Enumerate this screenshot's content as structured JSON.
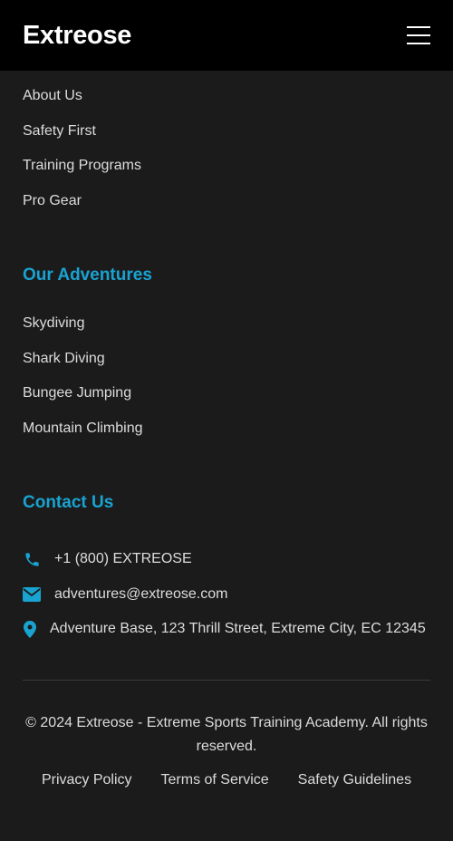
{
  "header": {
    "logo": "Extreose",
    "menu_icon": "hamburger-menu-icon"
  },
  "quick_links": {
    "items": [
      {
        "label": "About Us"
      },
      {
        "label": "Safety First"
      },
      {
        "label": "Training Programs"
      },
      {
        "label": "Pro Gear"
      }
    ]
  },
  "adventures": {
    "title": "Our Adventures",
    "items": [
      {
        "label": "Skydiving"
      },
      {
        "label": "Shark Diving"
      },
      {
        "label": "Bungee Jumping"
      },
      {
        "label": "Mountain Climbing"
      }
    ]
  },
  "contact": {
    "title": "Contact Us",
    "phone": "+1 (800) EXTREOSE",
    "email": "adventures@extreose.com",
    "address": "Adventure Base, 123 Thrill Street, Extreme City, EC 12345"
  },
  "footer": {
    "copyright": "© 2024 Extreose - Extreme Sports Training Academy. All rights reserved.",
    "links": [
      {
        "label": "Privacy Policy"
      },
      {
        "label": "Terms of Service"
      },
      {
        "label": "Safety Guidelines"
      }
    ]
  },
  "colors": {
    "accent": "#19a3d1",
    "background": "#1b1b1b",
    "header": "#000000"
  }
}
